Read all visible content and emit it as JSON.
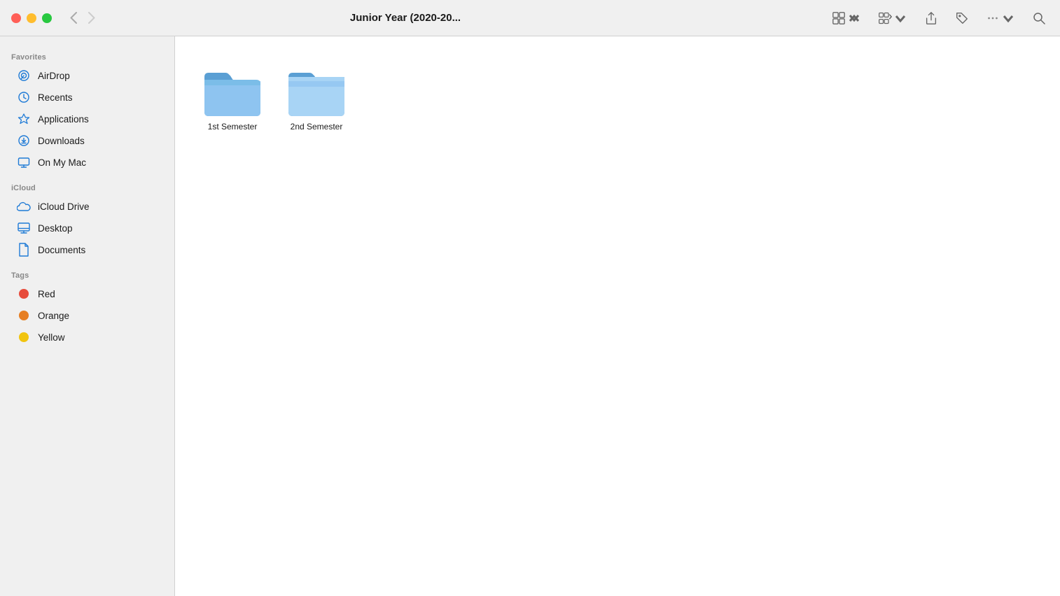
{
  "titleBar": {
    "title": "Junior Year (2020-20...",
    "windowControls": {
      "close": "close",
      "minimize": "minimize",
      "maximize": "maximize"
    },
    "backArrow": "‹",
    "forwardArrow": "›"
  },
  "toolbar": {
    "viewToggleLabel": "View options",
    "groupLabel": "Group",
    "shareLabel": "Share",
    "tagLabel": "Tag",
    "moreLabel": "More",
    "searchLabel": "Search"
  },
  "sidebar": {
    "favoritesHeader": "Favorites",
    "icloudHeader": "iCloud",
    "tagsHeader": "Tags",
    "items": {
      "favorites": [
        {
          "id": "airdrop",
          "label": "AirDrop",
          "icon": "airdrop"
        },
        {
          "id": "recents",
          "label": "Recents",
          "icon": "recents"
        },
        {
          "id": "applications",
          "label": "Applications",
          "icon": "applications"
        },
        {
          "id": "downloads",
          "label": "Downloads",
          "icon": "downloads"
        },
        {
          "id": "on-my-mac",
          "label": "On My Mac",
          "icon": "on-my-mac"
        }
      ],
      "icloud": [
        {
          "id": "icloud-drive",
          "label": "iCloud Drive",
          "icon": "icloud"
        },
        {
          "id": "desktop",
          "label": "Desktop",
          "icon": "desktop"
        },
        {
          "id": "documents",
          "label": "Documents",
          "icon": "documents"
        }
      ],
      "tags": [
        {
          "id": "red",
          "label": "Red",
          "color": "#e74c3c"
        },
        {
          "id": "orange",
          "label": "Orange",
          "color": "#e67e22"
        },
        {
          "id": "yellow",
          "label": "Yellow",
          "color": "#f1c40f"
        }
      ]
    }
  },
  "content": {
    "folders": [
      {
        "id": "1st-semester",
        "name": "1st Semester"
      },
      {
        "id": "2nd-semester",
        "name": "2nd Semester"
      }
    ]
  }
}
